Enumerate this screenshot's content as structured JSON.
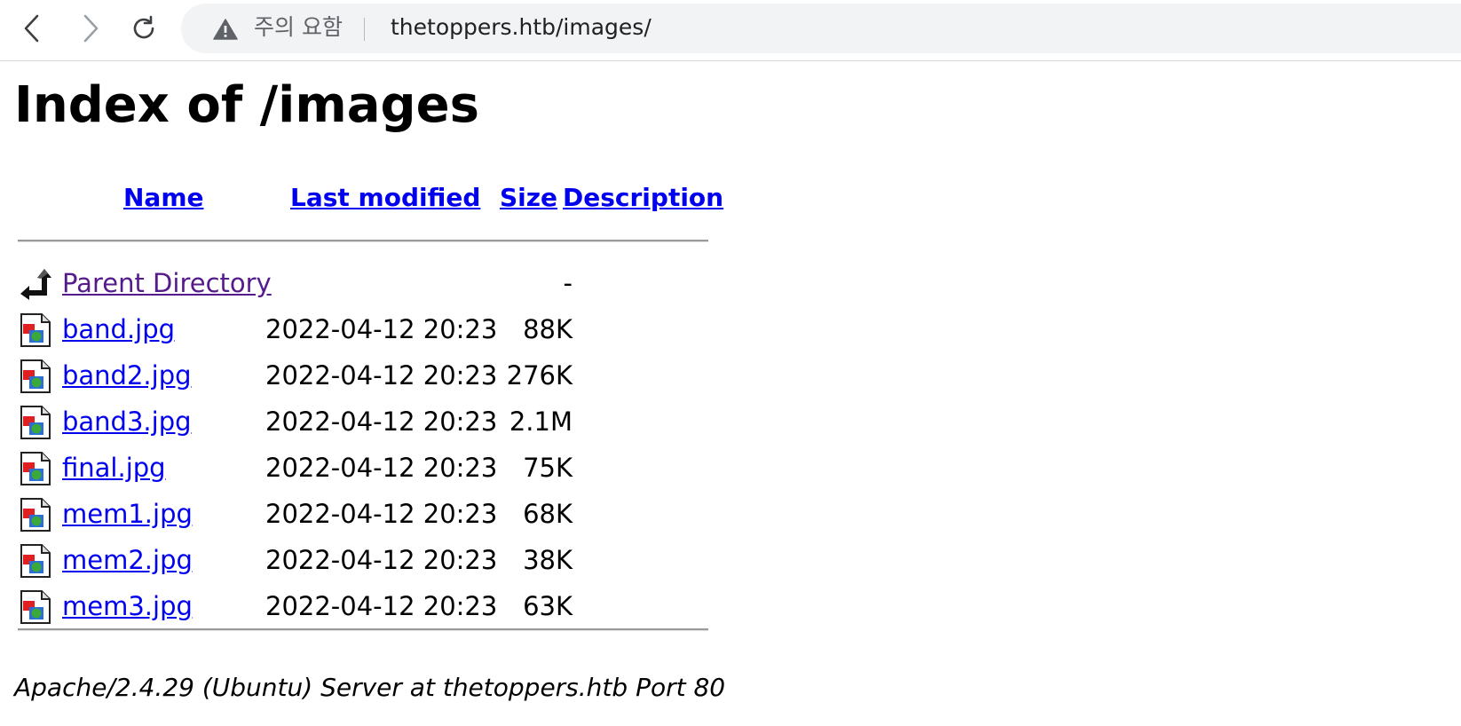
{
  "browser": {
    "security_warning": "주의 요함",
    "url": "thetoppers.htb/images/"
  },
  "page": {
    "title": "Index of /images",
    "columns": {
      "name": "Name",
      "last_modified": "Last modified",
      "size": "Size",
      "description": "Description"
    },
    "parent": {
      "name": "Parent Directory",
      "size": "-"
    },
    "files": [
      {
        "name": "band.jpg",
        "modified": "2022-04-12 20:23",
        "size": "88K"
      },
      {
        "name": "band2.jpg",
        "modified": "2022-04-12 20:23",
        "size": "276K"
      },
      {
        "name": "band3.jpg",
        "modified": "2022-04-12 20:23",
        "size": "2.1M"
      },
      {
        "name": "final.jpg",
        "modified": "2022-04-12 20:23",
        "size": "75K"
      },
      {
        "name": "mem1.jpg",
        "modified": "2022-04-12 20:23",
        "size": "68K"
      },
      {
        "name": "mem2.jpg",
        "modified": "2022-04-12 20:23",
        "size": "38K"
      },
      {
        "name": "mem3.jpg",
        "modified": "2022-04-12 20:23",
        "size": "63K"
      }
    ],
    "server_signature": "Apache/2.4.29 (Ubuntu) Server at thetoppers.htb Port 80"
  },
  "icons": {
    "back": "chevron-left-icon",
    "forward": "chevron-right-icon",
    "reload": "reload-icon",
    "warning": "warning-triangle-icon",
    "parent": "back-arrow-icon",
    "file": "image-file-icon"
  },
  "colors": {
    "link": "#0000ee",
    "visited_link": "#551a8b",
    "omnibox_bg": "#f1f3f4"
  }
}
